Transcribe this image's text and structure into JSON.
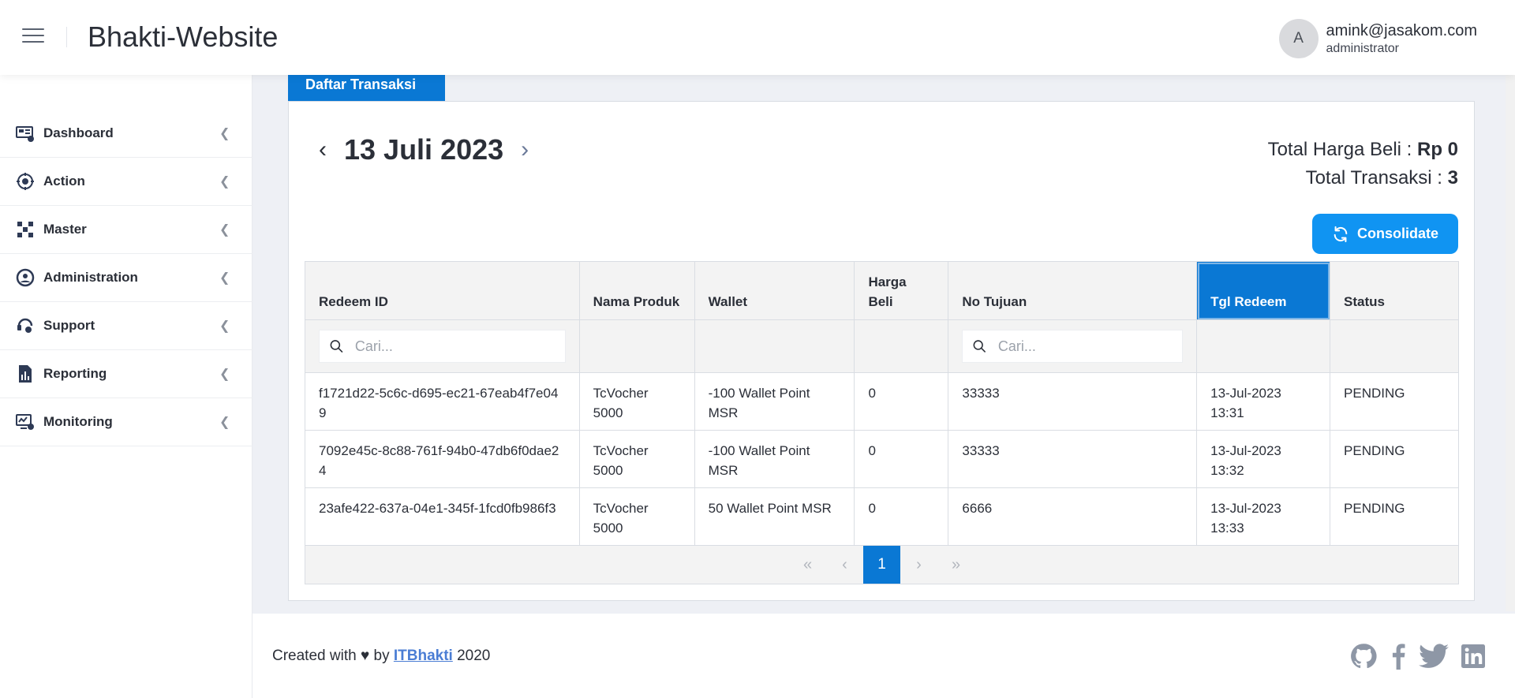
{
  "header": {
    "title": "Bhakti-Website",
    "user": {
      "initial": "A",
      "email": "amink@jasakom.com",
      "role": "administrator"
    }
  },
  "sidebar": {
    "items": [
      {
        "label": "Dashboard",
        "icon": "dashboard-icon"
      },
      {
        "label": "Action",
        "icon": "action-icon"
      },
      {
        "label": "Master",
        "icon": "master-icon"
      },
      {
        "label": "Administration",
        "icon": "administration-icon"
      },
      {
        "label": "Support",
        "icon": "support-icon"
      },
      {
        "label": "Reporting",
        "icon": "reporting-icon"
      },
      {
        "label": "Monitoring",
        "icon": "monitoring-icon"
      }
    ]
  },
  "main": {
    "tab_label": "Daftar Transaksi",
    "date_label": "13 Juli 2023",
    "totals": {
      "harga_label": "Total Harga Beli : ",
      "harga_value": "Rp 0",
      "transaksi_label": "Total Transaksi : ",
      "transaksi_value": "3"
    },
    "consolidate_label": "Consolidate",
    "table": {
      "columns": [
        "Redeem ID",
        "Nama Produk",
        "Wallet",
        "Harga Beli",
        "No Tujuan",
        "Tgl Redeem",
        "Status"
      ],
      "active_column": "Tgl Redeem",
      "search_placeholder": "Cari...",
      "rows": [
        {
          "redeem_id": "f1721d22-5c6c-d695-ec21-67eab4f7e049",
          "produk": "TcVocher 5000",
          "wallet": "-100 Wallet Point MSR",
          "harga": "0",
          "tujuan": "33333",
          "tgl": "13-Jul-2023 13:31",
          "status": "PENDING"
        },
        {
          "redeem_id": "7092e45c-8c88-761f-94b0-47db6f0dae24",
          "produk": "TcVocher 5000",
          "wallet": "-100 Wallet Point MSR",
          "harga": "0",
          "tujuan": "33333",
          "tgl": "13-Jul-2023 13:32",
          "status": "PENDING"
        },
        {
          "redeem_id": "23afe422-637a-04e1-345f-1fcd0fb986f3",
          "produk": "TcVocher 5000",
          "wallet": "50 Wallet Point MSR",
          "harga": "0",
          "tujuan": "6666",
          "tgl": "13-Jul-2023 13:33",
          "status": "PENDING"
        }
      ],
      "pager": {
        "first": "«",
        "prev": "‹",
        "current": "1",
        "next": "›",
        "last": "»"
      }
    }
  },
  "footer": {
    "prefix": "Created with ♥ by ",
    "link": "ITBhakti",
    "suffix": " 2020",
    "socials": [
      "github-icon",
      "facebook-icon",
      "twitter-icon",
      "linkedin-icon"
    ]
  }
}
